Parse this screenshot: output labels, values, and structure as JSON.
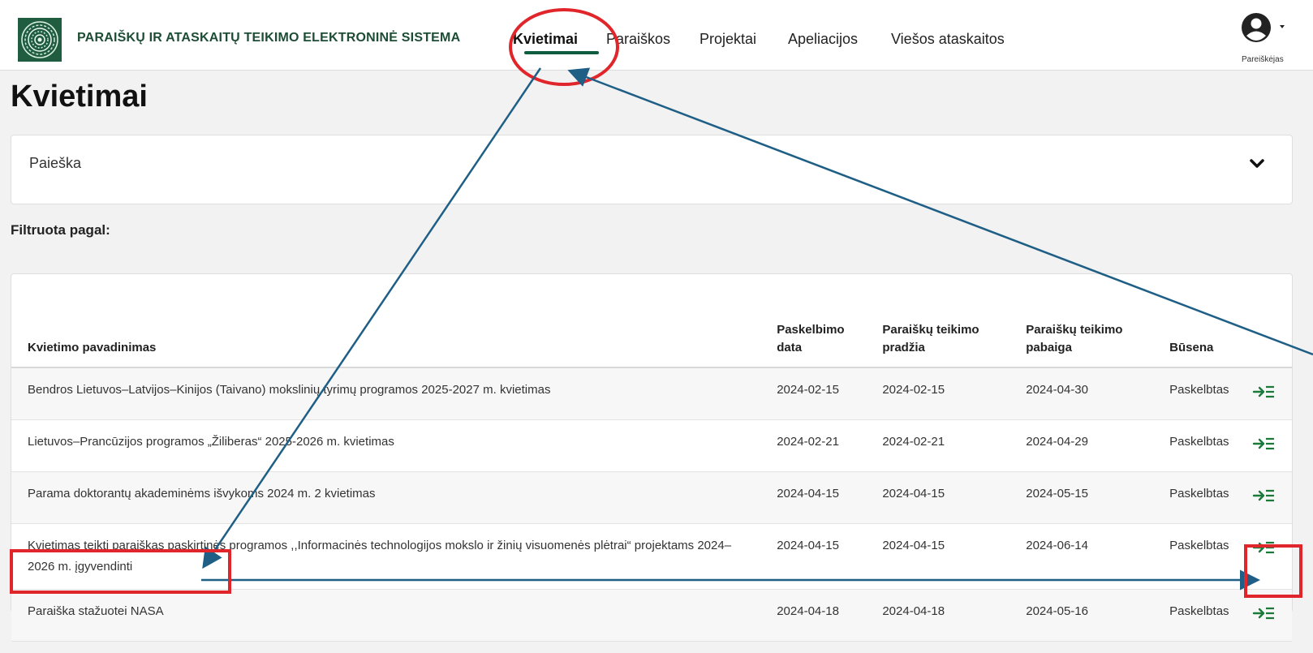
{
  "header": {
    "brand": "PARAIŠKŲ IR ATASKAITŲ TEIKIMO ELEKTRONINĖ SISTEMA",
    "nav": [
      {
        "label": "Kvietimai",
        "active": true
      },
      {
        "label": "Paraiškos",
        "active": false
      },
      {
        "label": "Projektai",
        "active": false
      },
      {
        "label": "Apeliacijos",
        "active": false
      },
      {
        "label": "Viešos ataskaitos",
        "active": false
      }
    ],
    "user_label": "Pareiškėjas"
  },
  "page": {
    "title": "Kvietimai",
    "search_label": "Paieška",
    "filter_label": "Filtruota pagal:"
  },
  "table": {
    "columns": [
      "Kvietimo pavadinimas",
      "Paskelbimo data",
      "Paraiškų teikimo pradžia",
      "Paraiškų teikimo pabaiga",
      "Būsena",
      ""
    ],
    "rows": [
      {
        "name": "Bendros Lietuvos–Latvijos–Kinijos (Taivano) mokslinių tyrimų programos 2025-2027 m. kvietimas",
        "published": "2024-02-15",
        "start": "2024-02-15",
        "end": "2024-04-30",
        "status": "Paskelbtas"
      },
      {
        "name": "Lietuvos–Prancūzijos programos „Žiliberas“ 2025-2026 m. kvietimas",
        "published": "2024-02-21",
        "start": "2024-02-21",
        "end": "2024-04-29",
        "status": "Paskelbtas"
      },
      {
        "name": "Parama doktorantų akademinėms išvykoms 2024 m. 2 kvietimas",
        "published": "2024-04-15",
        "start": "2024-04-15",
        "end": "2024-05-15",
        "status": "Paskelbtas"
      },
      {
        "name": "Kvietimas teikti paraiškas paskirtinės programos ,,Informacinės technologijos mokslo ir žinių visuomenės plėtrai“ projektams 2024–2026 m. įgyvendinti",
        "published": "2024-04-15",
        "start": "2024-04-15",
        "end": "2024-06-14",
        "status": "Paskelbtas"
      },
      {
        "name": "Paraiška stažuotei NASA",
        "published": "2024-04-18",
        "start": "2024-04-18",
        "end": "2024-05-16",
        "status": "Paskelbtas"
      }
    ]
  },
  "colors": {
    "brand_green": "#1d4d35",
    "nav_underline": "#0f5d3f",
    "action_icon": "#1a7a3a",
    "annotation_red": "#e0262b",
    "annotation_arrow": "#1f5f86"
  },
  "icons": {
    "logo": "emblem-logo-icon",
    "user": "user-account-icon",
    "user_dropdown": "caret-down-icon",
    "search_toggle": "chevron-down-icon",
    "row_action": "open-arrow-list-icon"
  }
}
